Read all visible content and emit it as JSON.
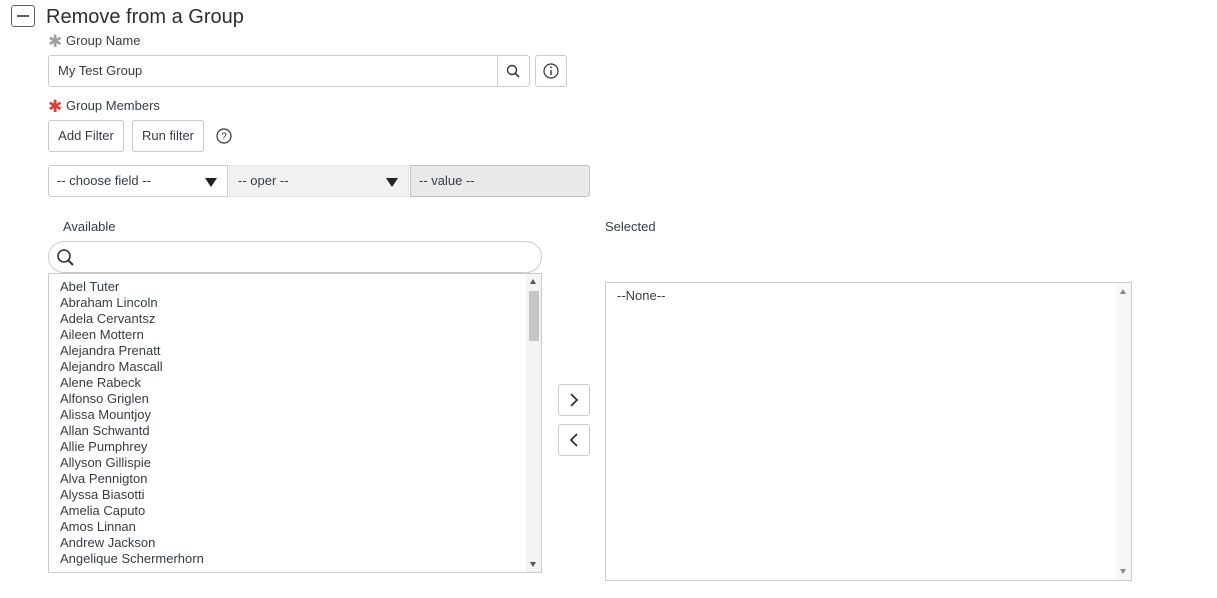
{
  "section": {
    "title": "Remove from a Group"
  },
  "group_name": {
    "label": "Group Name",
    "value": "My Test Group",
    "required_mark": "✱"
  },
  "group_members": {
    "label": "Group Members",
    "required_mark": "✱",
    "buttons": {
      "add_filter": "Add Filter",
      "run_filter": "Run filter"
    }
  },
  "filter": {
    "field_placeholder": "-- choose field --",
    "oper_placeholder": "-- oper --",
    "value_placeholder": "-- value --"
  },
  "available": {
    "label": "Available",
    "items": [
      "Abel Tuter",
      "Abraham Lincoln",
      "Adela Cervantsz",
      "Aileen Mottern",
      "Alejandra Prenatt",
      "Alejandro Mascall",
      "Alene Rabeck",
      "Alfonso Griglen",
      "Alissa Mountjoy",
      "Allan Schwantd",
      "Allie Pumphrey",
      "Allyson Gillispie",
      "Alva Pennigton",
      "Alyssa Biasotti",
      "Amelia Caputo",
      "Amos Linnan",
      "Andrew Jackson",
      "Angelique Schermerhorn"
    ]
  },
  "selected": {
    "label": "Selected",
    "items": [
      "--None--"
    ]
  },
  "colors": {
    "required_red": "#e03a3a",
    "required_grey": "#a0a0a0",
    "border": "#cbcbcb",
    "readonly_bg": "#e9e9e9"
  }
}
